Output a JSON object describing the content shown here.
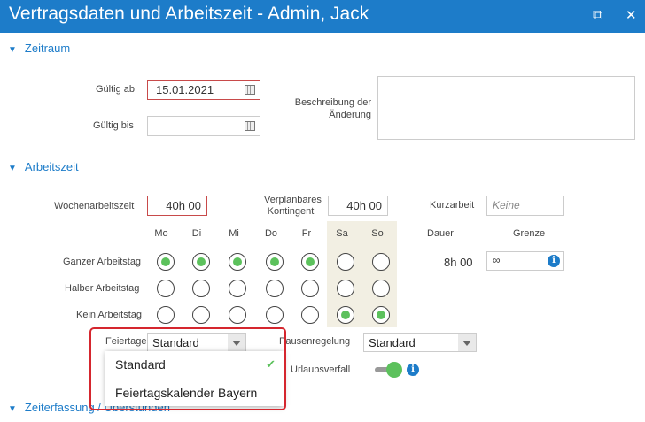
{
  "window": {
    "title": "Vertragsdaten und Arbeitszeit - Admin, Jack"
  },
  "sections": {
    "zeitraum": "Zeitraum",
    "arbeitszeit": "Arbeitszeit",
    "zeiterfassung": "Zeiterfassung / Überstunden"
  },
  "zeitraum": {
    "gueltig_ab_label": "Gültig ab",
    "gueltig_ab_value": "15.01.2021",
    "gueltig_bis_label": "Gültig bis",
    "gueltig_bis_value": "",
    "beschreibung_label_1": "Beschreibung der",
    "beschreibung_label_2": "Änderung"
  },
  "arbeitszeit": {
    "wochenarbeitszeit_label": "Wochenarbeitszeit",
    "wochenarbeitszeit_value": "40h 00",
    "verplanbares_label_1": "Verplanbares",
    "verplanbares_label_2": "Kontingent",
    "verplanbares_value": "40h 00",
    "kurzarbeit_label": "Kurzarbeit",
    "kurzarbeit_placeholder": "Keine",
    "days": [
      "Mo",
      "Di",
      "Mi",
      "Do",
      "Fr",
      "Sa",
      "So"
    ],
    "dauer_header": "Dauer",
    "grenze_header": "Grenze",
    "rows": [
      {
        "label": "Ganzer Arbeitstag",
        "selected": [
          true,
          true,
          true,
          true,
          true,
          false,
          false
        ]
      },
      {
        "label": "Halber Arbeitstag",
        "selected": [
          false,
          false,
          false,
          false,
          false,
          false,
          false
        ]
      },
      {
        "label": "Kein Arbeitstag",
        "selected": [
          false,
          false,
          false,
          false,
          false,
          true,
          true
        ]
      }
    ],
    "dauer_value": "8h 00",
    "grenze_value": "∞",
    "feiertage_label": "Feiertage",
    "feiertage_value": "Standard",
    "pausenregelung_label": "Pausenregelung",
    "pausenregelung_value": "Standard",
    "urlaubsverfall_label": "Urlaubsverfall",
    "urlaubsverfall_on": true
  },
  "feiertage_dropdown": {
    "options": [
      "Standard",
      "Feiertagskalender Bayern"
    ],
    "selected_index": 0
  },
  "colors": {
    "accent": "#1d7cc9",
    "radio_on": "#5cc15c",
    "required_border": "#c84a4a",
    "highlight": "#d5262e"
  }
}
